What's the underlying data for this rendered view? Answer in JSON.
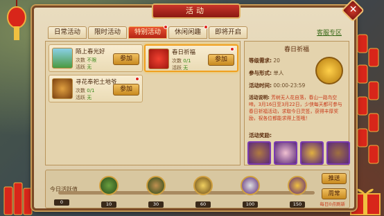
{
  "window": {
    "title": "活动",
    "close_icon": "close-icon"
  },
  "tabs": [
    {
      "label": "日常活动",
      "active": false,
      "dot": false
    },
    {
      "label": "限时活动",
      "active": false,
      "dot": false
    },
    {
      "label": "特别活动",
      "active": true,
      "dot": true
    },
    {
      "label": "休闲闲趣",
      "active": false,
      "dot": true
    },
    {
      "label": "即将开启",
      "active": false,
      "dot": false
    }
  ],
  "tab_right_link": "客服专区",
  "activities": [
    {
      "name": "陌上春光好",
      "count_label": "次数",
      "count_value": "不限",
      "active_label": "活跃",
      "active_value": "无",
      "button": "参加",
      "badge": false,
      "selected": false,
      "icon": "landscape-icon"
    },
    {
      "name": "春日祈福",
      "count_label": "次数",
      "count_value": "0/1",
      "active_label": "活跃",
      "active_value": "无",
      "button": "参加",
      "badge": true,
      "selected": true,
      "icon": "red-envelope-icon"
    },
    {
      "name": "寻花奉祀土地爷",
      "count_label": "次数",
      "count_value": "0/1",
      "active_label": "活跃",
      "active_value": "无",
      "button": "参加",
      "badge": true,
      "selected": false,
      "icon": "shrine-icon"
    }
  ],
  "detail": {
    "title": "春日祈福",
    "level_label": "等级需求:",
    "level_value": "20",
    "form_label": "参与形式:",
    "form_value": "单人",
    "time_label": "活动时间:",
    "time_value": "00:00-23:59",
    "desc_label": "活动说明:",
    "desc_text": "芳树无人花自落，春山一路鸟空啼。3月16日至3月22日，少侠每天都可参与春日祈福活动，求取今日灵签，获得丰厚奖励，祝各位都能求得上签哦！",
    "rewards_label": "活动奖励:",
    "rewards": [
      "chest-icon",
      "gem-icon",
      "key-icon",
      "chest-icon"
    ]
  },
  "progress": {
    "label": "今日活跃值",
    "milestones": [
      {
        "value": "0"
      },
      {
        "value": "10",
        "icon": "bow-icon"
      },
      {
        "value": "30",
        "icon": "treasure-chest-icon"
      },
      {
        "value": "60",
        "icon": "scroll-icon"
      },
      {
        "value": "100",
        "icon": "silver-ingot-icon"
      },
      {
        "value": "150",
        "icon": "gold-ingot-icon"
      }
    ],
    "push_button": "推送",
    "weekly_button": "周常",
    "reset_note": "每日0点刷新"
  },
  "colors": {
    "accent": "#c8352a",
    "panel": "#e9dcbf",
    "button": "#e0a840"
  }
}
